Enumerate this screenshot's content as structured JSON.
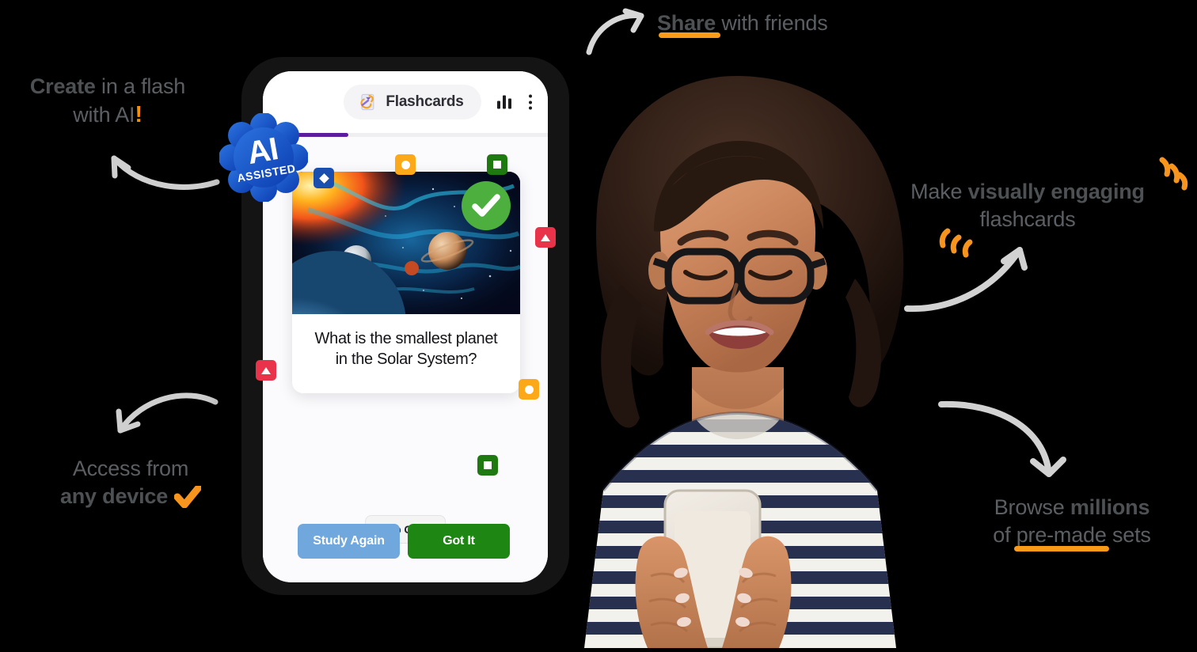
{
  "theme": {
    "background": "#000000",
    "accent_orange": "#F99B18",
    "caption_gray": "#5b5f63",
    "progress_purple": "#5b1d9e",
    "badge_blue": "#1B4FAF",
    "badge_orange": "#FBA919",
    "badge_green": "#1E7A10",
    "badge_red": "#E8334A",
    "study_again_blue": "#70A7DD",
    "got_it_green": "#1E8613",
    "ai_badge_blue": "#1558C8"
  },
  "annotations": [
    {
      "id": "create",
      "line1_bold": "Create",
      "line1_rest": " in a flash",
      "line2": "with AI",
      "exclamation": "!",
      "has_orange_underline": false
    },
    {
      "id": "share",
      "bold": "Share",
      "rest": " with friends",
      "has_orange_underline": true
    },
    {
      "id": "make",
      "line1_plain": "Make ",
      "line1_bold": "visually engaging",
      "line2": "flashcards",
      "has_orange_underline": false
    },
    {
      "id": "access",
      "line1": "Access from",
      "line2_bold": "any device",
      "has_orange_check": true
    },
    {
      "id": "browse",
      "line1_plain": "Browse ",
      "line1_bold": "millions",
      "line2": "of pre-made sets",
      "has_orange_underline": true
    }
  ],
  "ai_badge": {
    "title": "AI",
    "subtitle": "ASSISTED"
  },
  "phone": {
    "header": {
      "app_title": "Flashcards",
      "app_icon": "flashcards-icon",
      "stats_icon": "bar-chart-icon",
      "menu_icon": "three-dot-menu-icon"
    },
    "progress": {
      "percent": 30
    },
    "flashcard": {
      "image_alt": "space-scene-planets",
      "status_icon": "check-circle-icon",
      "question": "What is the smallest planet in the Solar System?"
    },
    "buttons": {
      "flip": "Flip Card",
      "study_again": "Study Again",
      "got_it": "Got It"
    }
  },
  "floating_badges": [
    {
      "name": "badge-diamond-blue",
      "shape": "diamond",
      "color": "#1B4FAF"
    },
    {
      "name": "badge-circle-orange",
      "shape": "circle",
      "color": "#FBA919"
    },
    {
      "name": "badge-square-green",
      "shape": "square",
      "color": "#1E7A10"
    },
    {
      "name": "badge-triangle-red-right",
      "shape": "triangle",
      "color": "#E8334A"
    },
    {
      "name": "badge-triangle-red-left",
      "shape": "triangle",
      "color": "#E8334A"
    },
    {
      "name": "badge-circle-orange-right",
      "shape": "circle",
      "color": "#FBA919"
    },
    {
      "name": "badge-square-green-low",
      "shape": "square",
      "color": "#1E7A10"
    }
  ]
}
